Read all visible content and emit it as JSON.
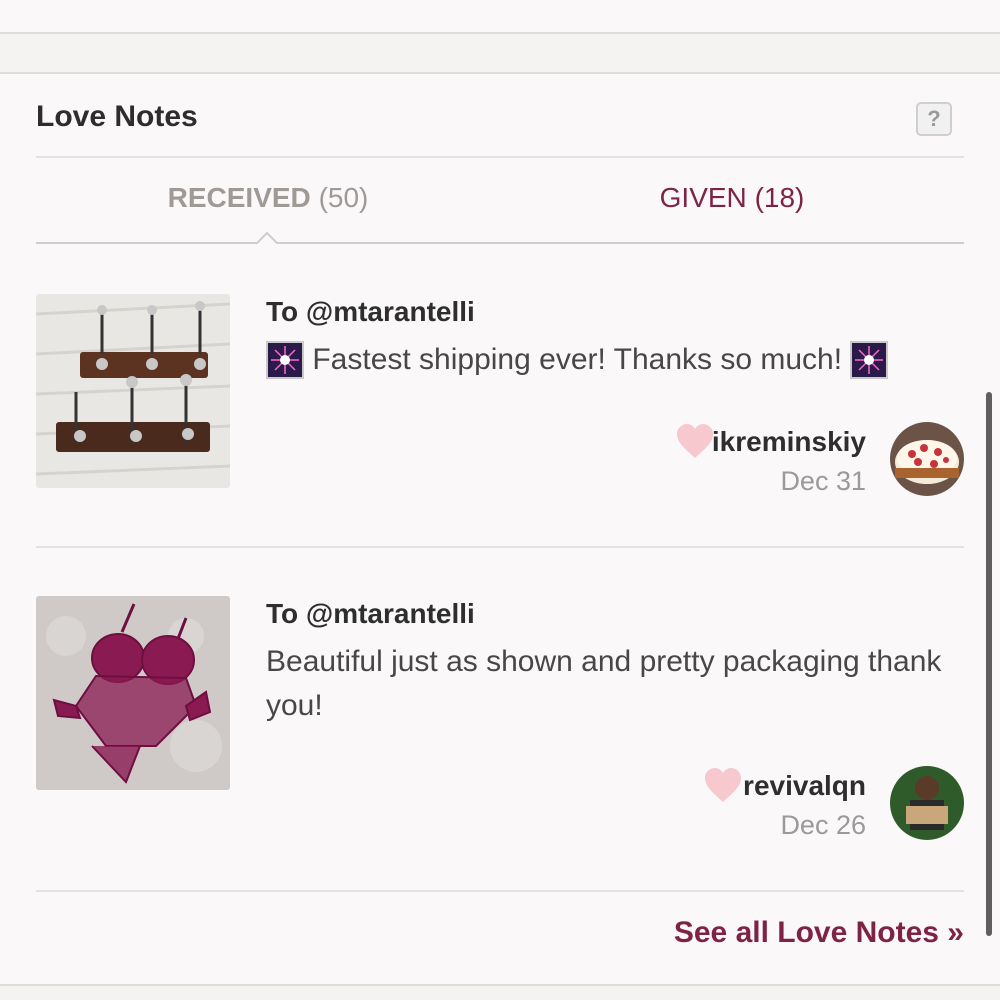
{
  "colors": {
    "accent": "#7f2346",
    "muted": "#9a9a9a",
    "heart": "#f7c9ce"
  },
  "panel": {
    "title": "Love Notes",
    "help_label": "?"
  },
  "tabs": {
    "received": {
      "label": "RECEIVED",
      "count": "(50)"
    },
    "given": {
      "label": "GIVEN",
      "count": "(18)"
    }
  },
  "notes": [
    {
      "to": "To @mtarantelli",
      "message": "Fastest shipping ever! Thanks so much!",
      "giver": "ikreminskiy",
      "date": "Dec 31",
      "icons": [
        "sparkle-icon",
        "heart-icon"
      ]
    },
    {
      "to": "To @mtarantelli",
      "message": "Beautiful just as shown and pretty packaging thank you!",
      "giver": "revivalqn",
      "date": "Dec 26",
      "icons": [
        "heart-icon"
      ]
    }
  ],
  "footer": {
    "see_all": "See all Love Notes »"
  }
}
